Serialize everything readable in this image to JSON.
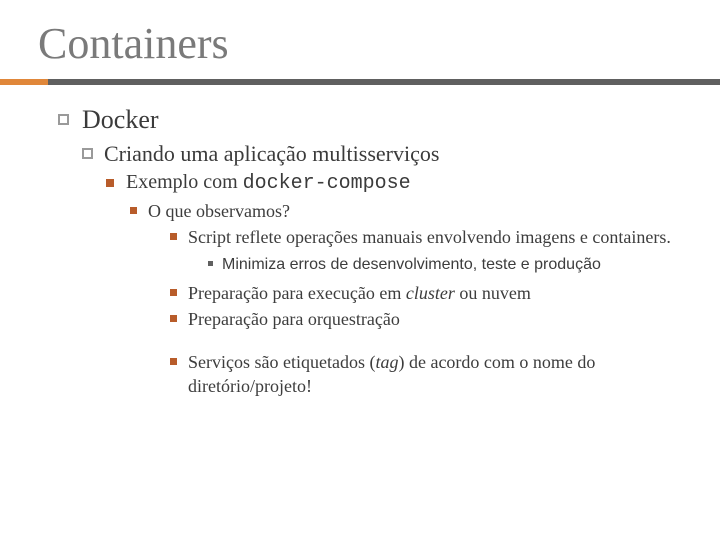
{
  "title": "Containers",
  "l1": "Docker",
  "l2": "Criando uma aplicação multisserviços",
  "l3_pre": "Exemplo com ",
  "l3_code": "docker-compose",
  "l4a": "O que observamos?",
  "l5a": "Script reflete operações manuais envolvendo imagens e containers.",
  "l6a": "Minimiza erros de desenvolvimento, teste e produção",
  "l5b_pre": "Preparação para execução em ",
  "l5b_it": "cluster",
  "l5b_post": " ou nuvem",
  "l5c": "Preparação para orquestração",
  "l5d_pre": "Serviços são etiquetados (",
  "l5d_it": "tag",
  "l5d_post": ") de acordo com o nome do diretório/projeto!"
}
